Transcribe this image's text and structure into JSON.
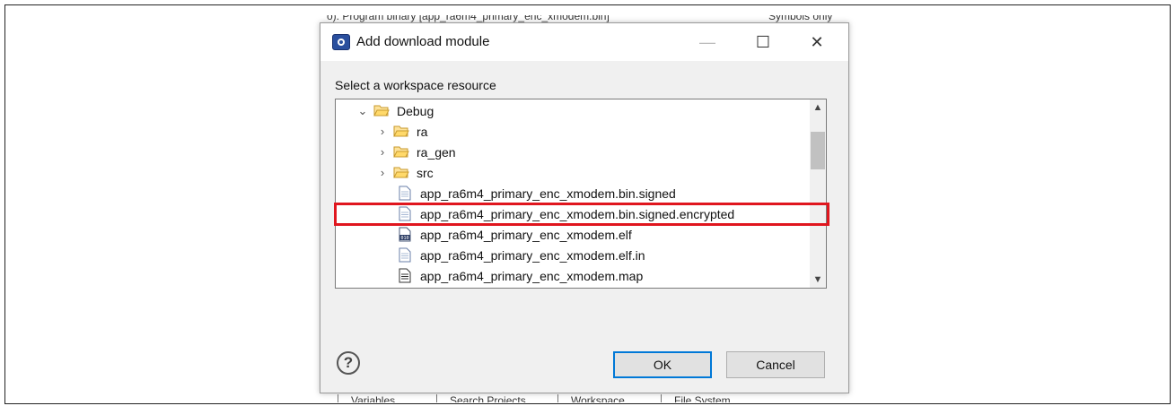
{
  "dialog": {
    "title": "Add download module",
    "prompt": "Select a workspace resource",
    "ok_label": "OK",
    "cancel_label": "Cancel",
    "help_symbol": "?",
    "minimize_symbol": "—",
    "maximize_symbol": "☐",
    "close_symbol": "✕"
  },
  "tree": {
    "items": [
      {
        "label": "Debug",
        "type": "folder",
        "expanded": true
      },
      {
        "label": "ra",
        "type": "folder",
        "expanded": false
      },
      {
        "label": "ra_gen",
        "type": "folder",
        "expanded": false
      },
      {
        "label": "src",
        "type": "folder",
        "expanded": false
      },
      {
        "label": "app_ra6m4_primary_enc_xmodem.bin.signed",
        "type": "file"
      },
      {
        "label": "app_ra6m4_primary_enc_xmodem.bin.signed.encrypted",
        "type": "file",
        "highlighted": true
      },
      {
        "label": "app_ra6m4_primary_enc_xmodem.elf",
        "type": "binary-file"
      },
      {
        "label": "app_ra6m4_primary_enc_xmodem.elf.in",
        "type": "file"
      },
      {
        "label": "app_ra6m4_primary_enc_xmodem.map",
        "type": "text-file"
      }
    ]
  },
  "background": {
    "top_strip_left": "o): Program binary [app_ra6m4_primary_enc_xmodem.bin]",
    "top_strip_right": "Symbols only",
    "bottom_tabs": [
      "Variables",
      "Search Projects",
      "Workspace...",
      "File System..."
    ]
  },
  "colors": {
    "highlight": "#e0161e",
    "ok_focus": "#0078d7"
  }
}
